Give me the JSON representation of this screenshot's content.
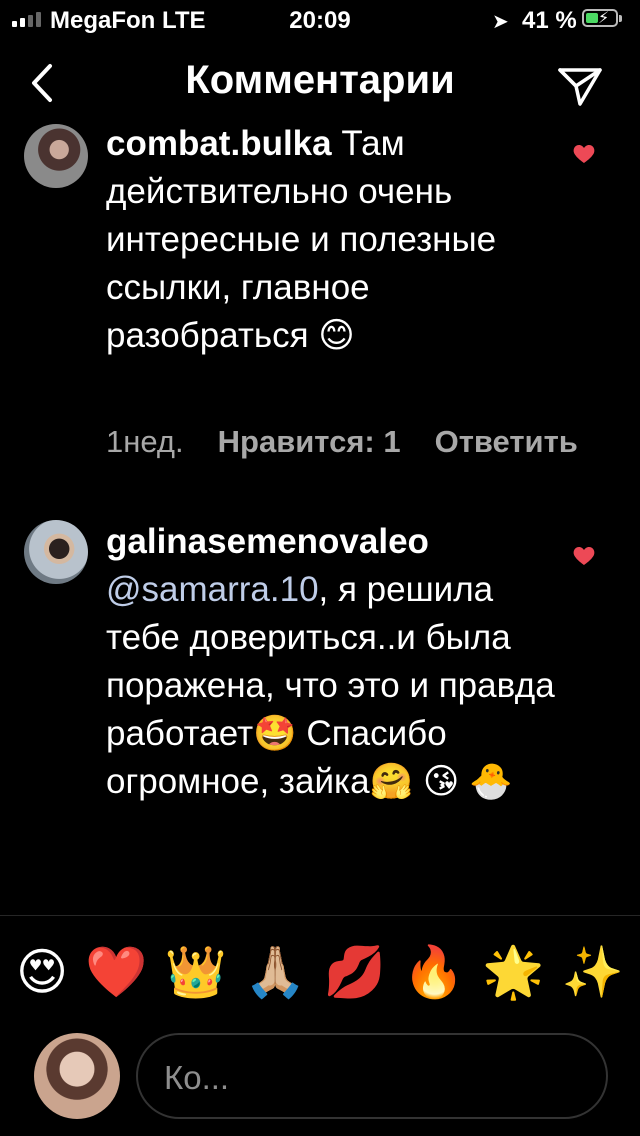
{
  "status_bar": {
    "carrier": "MegaFon LTE",
    "time": "20:09",
    "battery": "41 %",
    "signal_bars": 2
  },
  "nav": {
    "title": "Комментарии",
    "back_icon": "chevron-left-icon",
    "send_icon": "paper-plane-icon"
  },
  "comments": [
    {
      "username": "combat.bulka",
      "text": " Там действительно очень интересные и полезные ссылки, главное разобраться 😊",
      "time": "1нед.",
      "likes_label": "Нравится: 1",
      "reply_label": "Ответить",
      "liked": true
    },
    {
      "username": "galinasemenovaleo",
      "mention": "@samarra.10",
      "text": ", я решила тебе довериться..и была поражена, что это и правда работает🤩 Спасибо огромное, зайка🤗 😘 🐣",
      "liked": true
    }
  ],
  "emoji_bar": [
    "😍",
    "❤️",
    "👑",
    "🙏🏼",
    "💋",
    "🔥",
    "🌟",
    "✨"
  ],
  "input": {
    "placeholder": "Ко..."
  },
  "colors": {
    "background": "#000000",
    "heart": "#ed4956",
    "mention": "#bfcde8",
    "muted": "#a8a8a8"
  }
}
